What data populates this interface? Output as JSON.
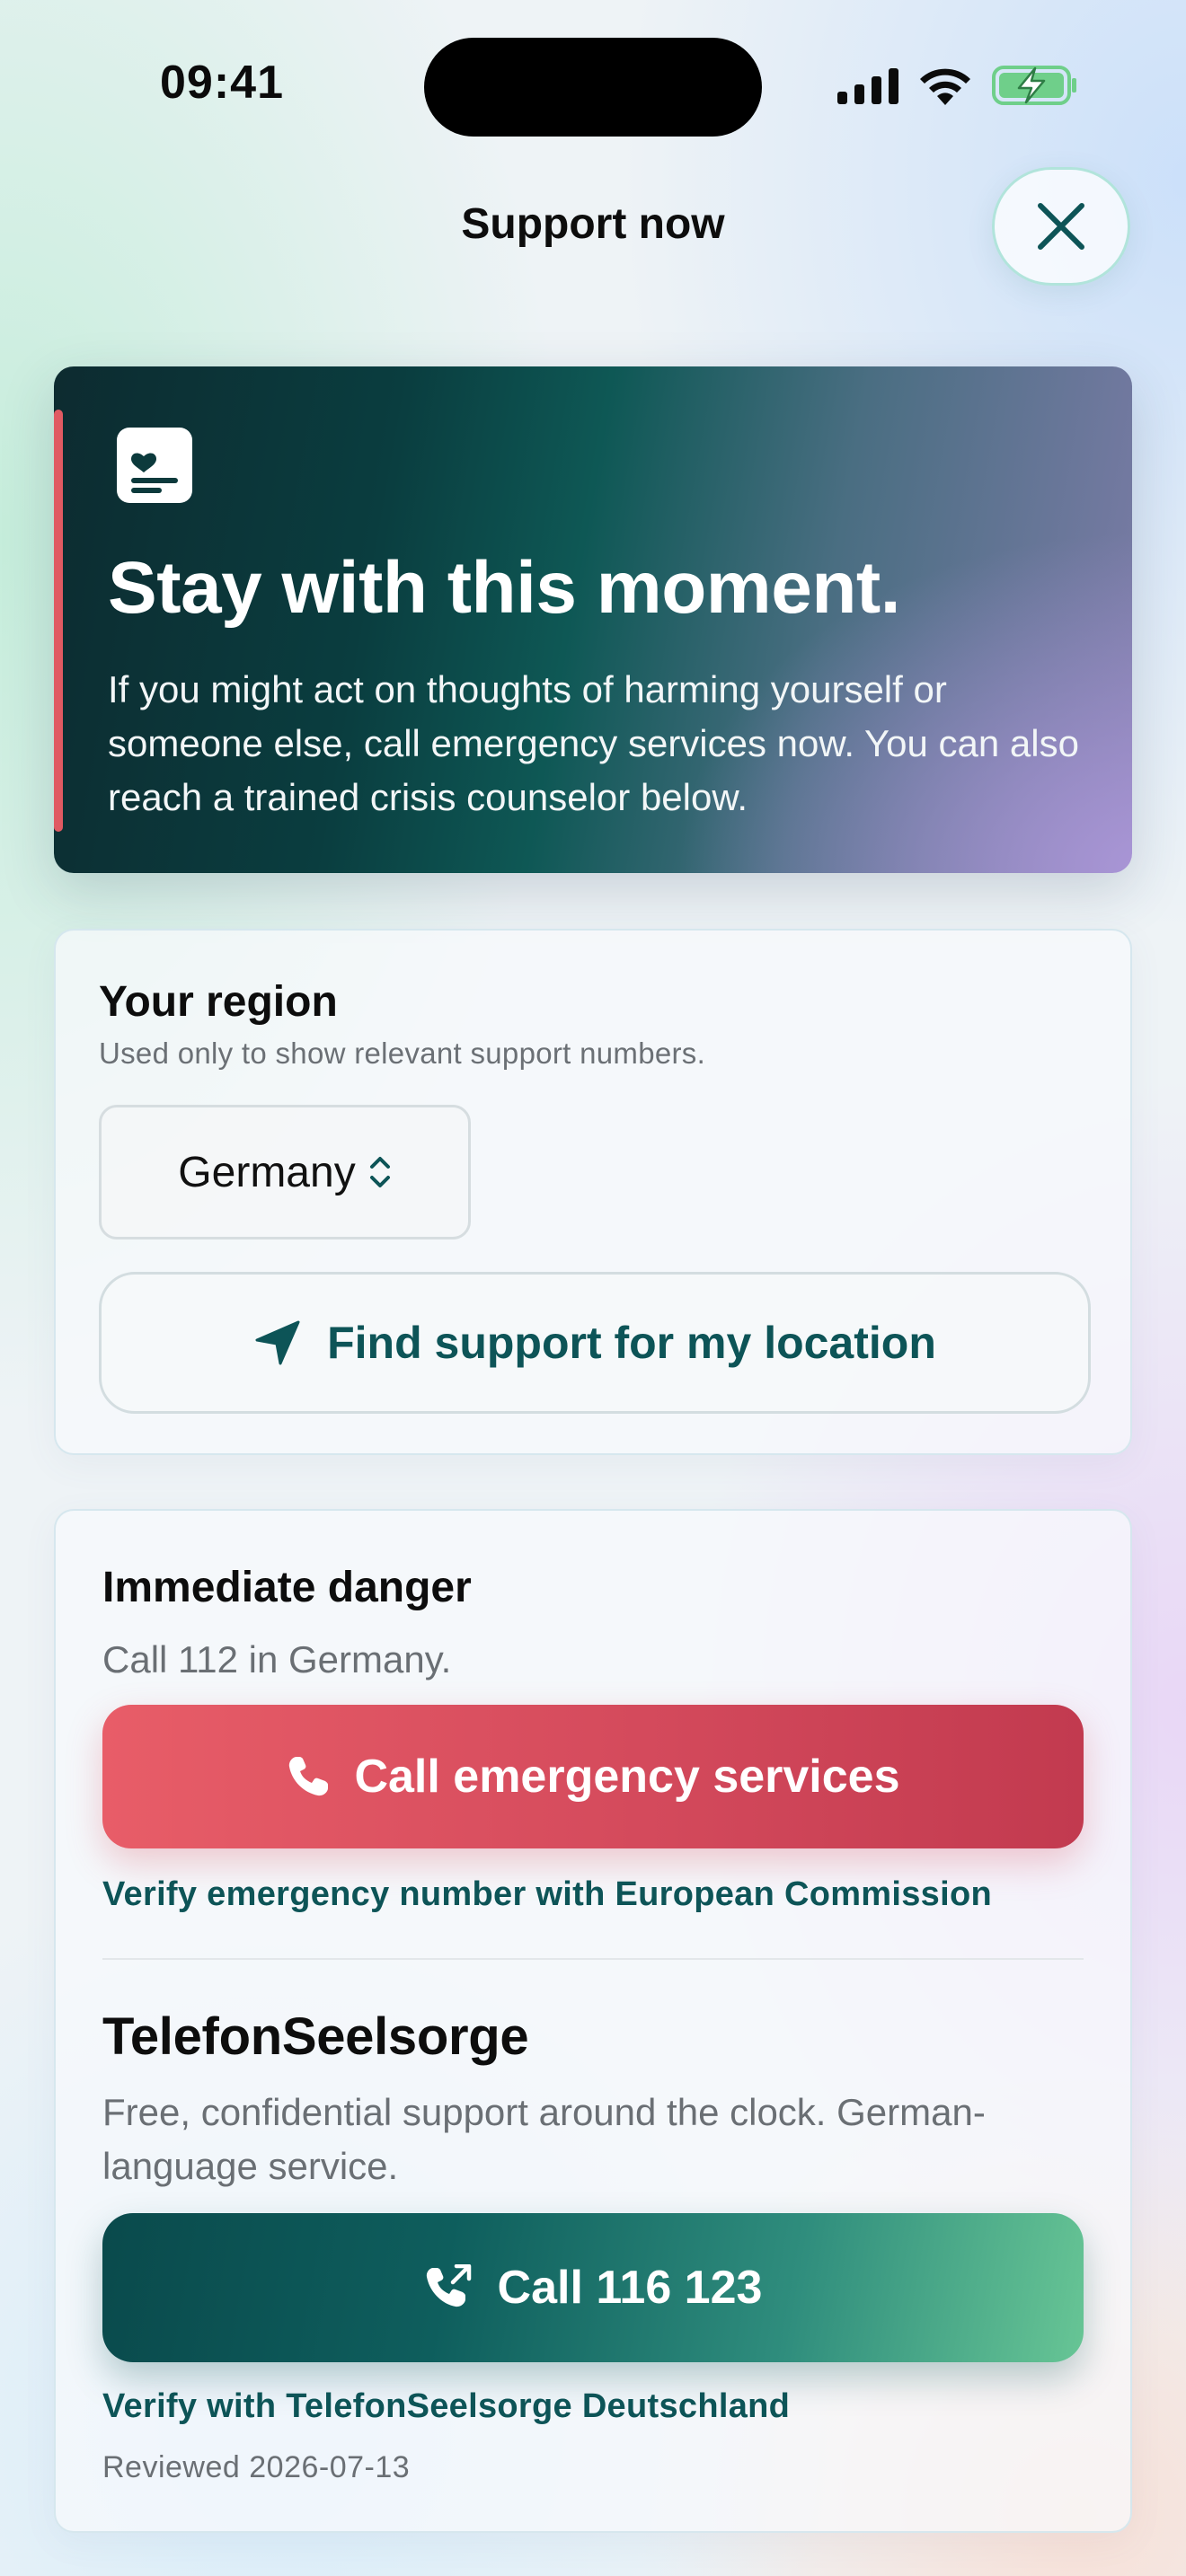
{
  "status_bar": {
    "time": "09:41",
    "icons": [
      "cellular-signal-icon",
      "wifi-icon",
      "battery-charging-icon"
    ]
  },
  "header": {
    "title": "Support now",
    "close_icon": "close-icon"
  },
  "hero": {
    "icon": "heart-document-icon",
    "title": "Stay with this moment.",
    "body": "If you might act on thoughts of harming yourself or someone else, call emergency services now. You can also reach a trained crisis counselor below."
  },
  "region": {
    "title": "Your region",
    "subtitle": "Used only to show relevant support numbers.",
    "selected_country": "Germany",
    "find_button_label": "Find support for my location"
  },
  "emergency": {
    "title": "Immediate danger",
    "subtitle": "Call 112 in Germany.",
    "button_label": "Call emergency services",
    "verify_link": "Verify emergency number with European Commission"
  },
  "helpline": {
    "name": "TelefonSeelsorge",
    "description": "Free, confidential support around the clock. German-language service.",
    "button_label": "Call 116 123",
    "verify_link": "Verify with TelefonSeelsorge Deutschland",
    "reviewed": "Reviewed 2026-07-13"
  },
  "colors": {
    "accent_teal": "#0d5457",
    "emergency_red": "#d44a5c",
    "hero_stripe": "#e05a62"
  }
}
